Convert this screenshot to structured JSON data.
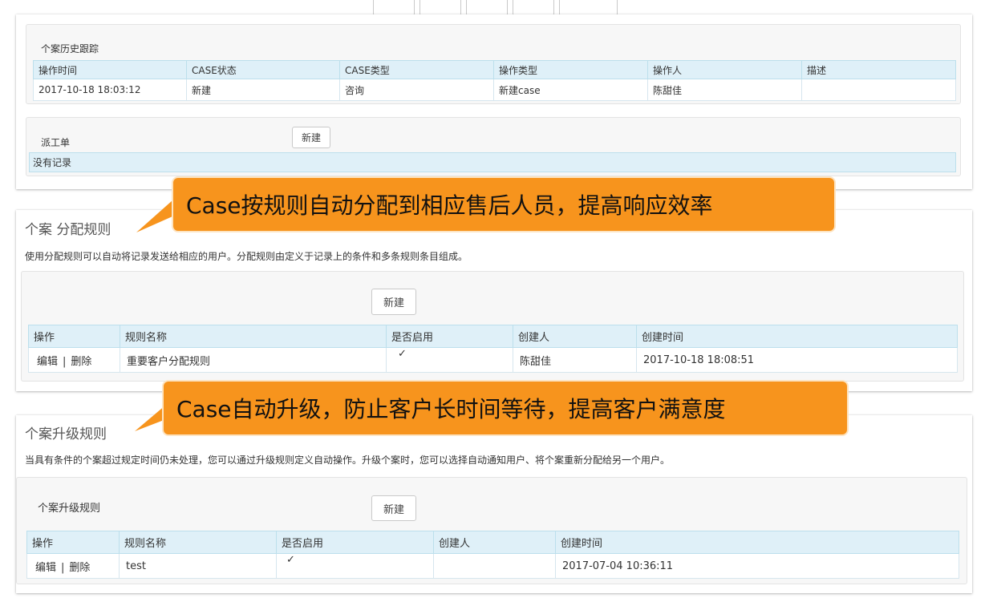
{
  "top_buttons": [
    "",
    "",
    "",
    "",
    ""
  ],
  "history": {
    "title": "个案历史跟踪",
    "columns": [
      "操作时间",
      "CASE状态",
      "CASE类型",
      "操作类型",
      "操作人",
      "描述"
    ],
    "rows": [
      [
        "2017-10-18 18:03:12",
        "新建",
        "咨询",
        "新建case",
        "陈甜佳",
        ""
      ]
    ]
  },
  "dispatch": {
    "title": "派工单",
    "new_label": "新建",
    "empty_text": "没有记录"
  },
  "callout1": "Case按规则自动分配到相应售后人员，提高响应效率",
  "assignment": {
    "title": "个案 分配规则",
    "description": "使用分配规则可以自动将记录发送给相应的用户。分配规则由定义于记录上的条件和多条规则条目组成。",
    "new_label": "新建",
    "columns": [
      "操作",
      "规则名称",
      "是否启用",
      "创建人",
      "创建时间"
    ],
    "row": {
      "edit": "编辑",
      "sep": "|",
      "delete": "删除",
      "name": "重要客户分配规则",
      "enabled": "✓",
      "creator": "陈甜佳",
      "created": "2017-10-18 18:08:51"
    }
  },
  "callout2": "Case自动升级，防止客户长时间等待，提高客户满意度",
  "escalation": {
    "title": "个案升级规则",
    "description": "当具有条件的个案超过规定时间仍未处理，您可以通过升级规则定义自动操作。升级个案时，您可以选择自动通知用户、将个案重新分配给另一个用户。",
    "subtitle": "个案升级规则",
    "new_label": "新建",
    "columns": [
      "操作",
      "规则名称",
      "是否启用",
      "创建人",
      "创建时间"
    ],
    "row": {
      "edit": "编辑",
      "sep": "|",
      "delete": "删除",
      "name": "test",
      "enabled": "✓",
      "creator": "",
      "created": "2017-07-04 10:36:11"
    }
  },
  "colors": {
    "callout": "#f7941d",
    "header": "#dff0f8"
  }
}
